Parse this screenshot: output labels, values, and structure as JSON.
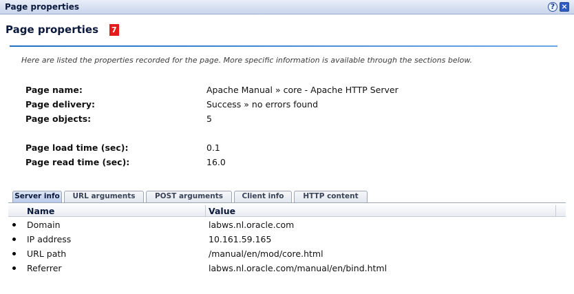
{
  "window": {
    "title": "Page properties",
    "help_icon": "?",
    "close_icon": "×"
  },
  "header": {
    "title": "Page properties",
    "badge": "7"
  },
  "intro": "Here are listed the properties recorded for the page. More specific information is available through the sections below.",
  "properties": [
    {
      "label": "Page name:",
      "value": "Apache Manual » core - Apache HTTP Server"
    },
    {
      "label": "Page delivery:",
      "value": "Success » no errors found"
    },
    {
      "label": "Page objects:",
      "value": "5"
    },
    {
      "label": "Page load time (sec):",
      "value": "0.1"
    },
    {
      "label": "Page read time (sec):",
      "value": "16.0"
    }
  ],
  "tabs": [
    {
      "label": "Server info",
      "active": true
    },
    {
      "label": "URL arguments",
      "active": false
    },
    {
      "label": "POST arguments",
      "active": false
    },
    {
      "label": "Client info",
      "active": false
    },
    {
      "label": "HTTP content",
      "active": false
    }
  ],
  "table": {
    "headers": [
      "Name",
      "Value"
    ],
    "rows": [
      {
        "name": "Domain",
        "value": "labws.nl.oracle.com"
      },
      {
        "name": "IP address",
        "value": "10.161.59.165"
      },
      {
        "name": "URL path",
        "value": "/manual/en/mod/core.html"
      },
      {
        "name": "Referrer",
        "value": "labws.nl.oracle.com/manual/en/bind.html"
      }
    ]
  }
}
